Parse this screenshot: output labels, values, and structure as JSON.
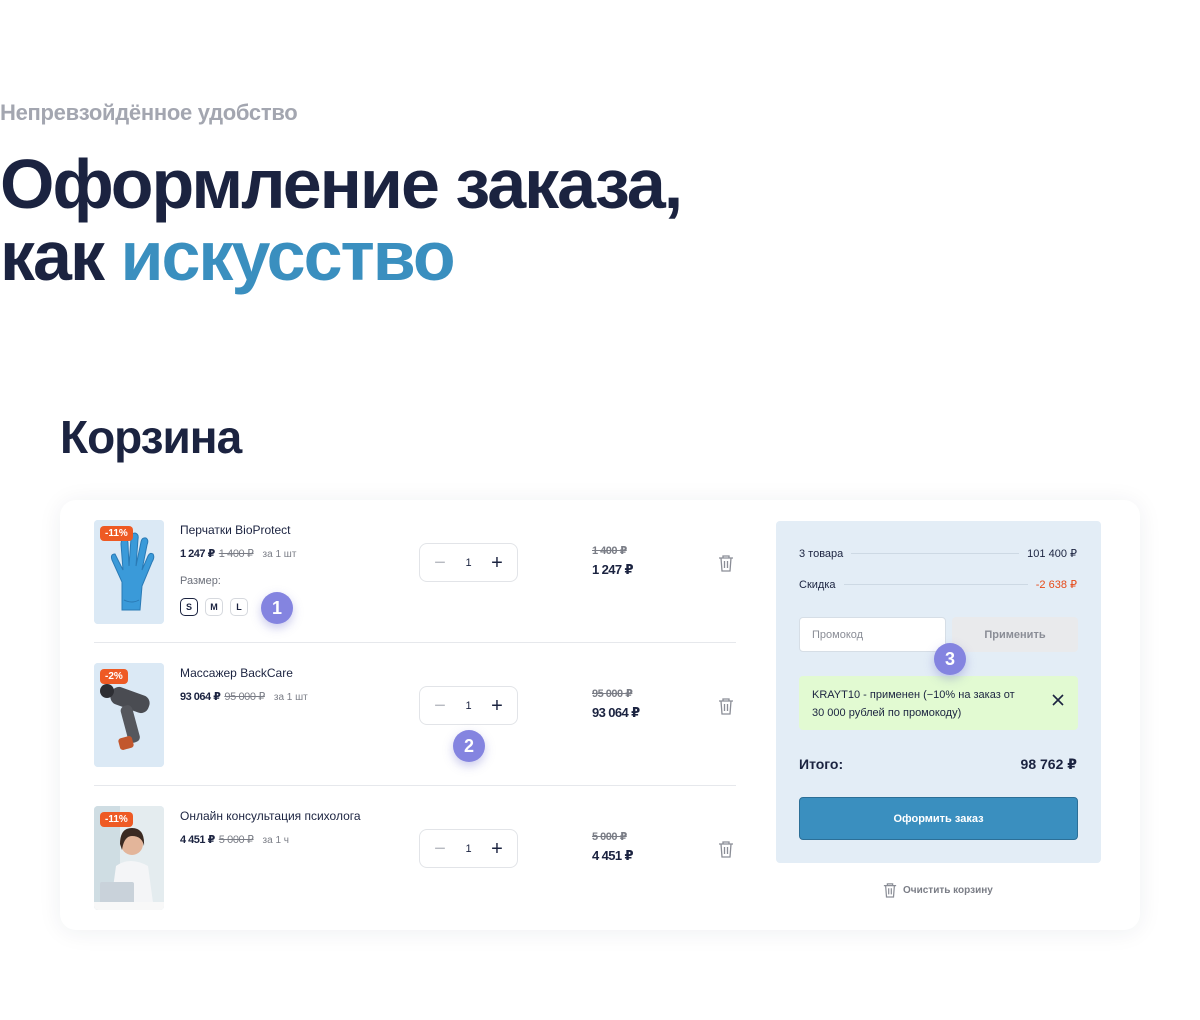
{
  "header": {
    "subtitle": "Непревзойдённое удобство",
    "title_line1": "Оформление заказа,",
    "title_line2_plain": "как",
    "title_line2_accent": "искусство"
  },
  "cart": {
    "title": "Корзина",
    "items": [
      {
        "badge": "-11%",
        "name": "Перчатки BioProtect",
        "price": "1 247 ₽",
        "old_price": "1 400 ₽",
        "unit": "за 1 шт",
        "size_label": "Размер:",
        "sizes": [
          "S",
          "M",
          "L"
        ],
        "selected_size": "S",
        "qty": "1",
        "total_old": "1 400 ₽",
        "total_new": "1 247 ₽",
        "image_icon": "glove-icon"
      },
      {
        "badge": "-2%",
        "name": "Массажер BackCare",
        "price": "93 064 ₽",
        "old_price": "95 000 ₽",
        "unit": "за 1 шт",
        "qty": "1",
        "total_old": "95 000 ₽",
        "total_new": "93 064 ₽",
        "image_icon": "massage-gun-icon"
      },
      {
        "badge": "-11%",
        "name": "Онлайн консультация психолога",
        "price": "4 451 ₽",
        "old_price": "5 000 ₽",
        "unit": "за 1 ч",
        "qty": "1",
        "total_old": "5 000 ₽",
        "total_new": "4 451 ₽",
        "image_icon": "psychologist-photo"
      }
    ],
    "stepper": {
      "minus": "−",
      "plus": "+"
    }
  },
  "summary": {
    "items_label": "3 товара",
    "items_total": "101 400 ₽",
    "discount_label": "Скидка",
    "discount_value": "-2 638 ₽",
    "promo_placeholder": "Промокод",
    "promo_apply": "Применить",
    "promo_applied_text": "KRAYT10 - применен (−10% на заказ от 30 000 рублей по промокоду)",
    "total_label": "Итого:",
    "total_value": "98 762 ₽",
    "checkout_button": "Оформить заказ",
    "clear_cart": "Очистить корзину"
  },
  "markers": [
    "1",
    "2",
    "3"
  ],
  "colors": {
    "primary": "#3a8fbf",
    "dark": "#1b2340",
    "badge": "#ee5a24",
    "discount": "#e64a19",
    "marker": "#8484e0",
    "promo_ok_bg": "#e2fad2",
    "summary_bg": "#e3edf6"
  }
}
